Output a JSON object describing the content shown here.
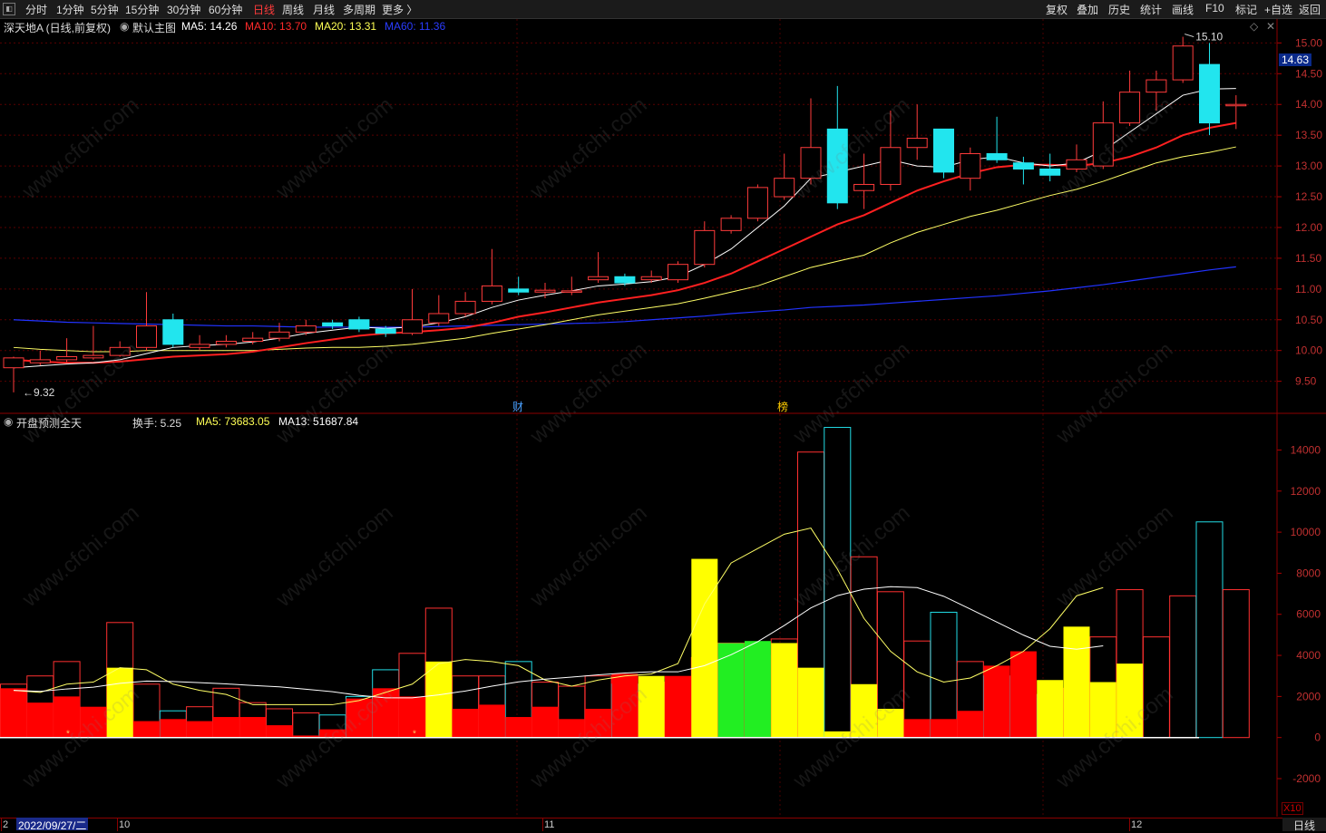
{
  "toolbar": {
    "periods": [
      "分时",
      "1分钟",
      "5分钟",
      "15分钟",
      "30分钟",
      "60分钟",
      "日线",
      "周线",
      "月线",
      "多周期",
      "更多 〉"
    ],
    "active_period": "日线",
    "right_items": [
      "复权",
      "叠加",
      "历史",
      "统计",
      "画线",
      "F10",
      "标记",
      "+自选",
      "返回"
    ]
  },
  "chart_info": {
    "stock_name": "深天地A (日线,前复权)",
    "template": "默认主图",
    "ma5": "MA5: 14.26",
    "ma10": "MA10: 13.70",
    "ma20": "MA20: 13.31",
    "ma60": "MA60: 11.36",
    "current_price": "14.63",
    "high_label": "15.10",
    "low_label": "9.32",
    "event_caiwu": "财",
    "event_bang": "榜"
  },
  "indicator_info": {
    "name": "开盘预测全天",
    "turnover": "换手: 5.25",
    "ma5": "MA5: 73683.05",
    "ma13": "MA13: 51687.84",
    "multiplier": "X10"
  },
  "bottom": {
    "selected_date": "2022/09/27/二",
    "month_labels": [
      "2",
      "10",
      "11",
      "12"
    ],
    "period": "日线"
  },
  "watermark": "www.cfchi.com",
  "colors": {
    "up": "#ff3b3b",
    "down": "#22e5ee",
    "ma5": "#ffffff",
    "ma10": "#ff2020",
    "ma20": "#ffff66",
    "ma60": "#2233ff",
    "vol_red": "#ff0000",
    "vol_yellow": "#ffff00",
    "vol_green": "#22ee22"
  },
  "chart_data": [
    {
      "type": "candlestick",
      "price_axis_ticks": [
        9.5,
        10.0,
        10.5,
        11.0,
        11.5,
        12.0,
        12.5,
        13.0,
        13.5,
        14.0,
        14.5,
        15.0
      ],
      "ylim": [
        9.2,
        15.3
      ],
      "candles": [
        [
          9.72,
          9.88,
          9.32,
          9.9
        ],
        [
          9.8,
          9.85,
          9.76,
          10.0
        ],
        [
          9.85,
          9.9,
          9.8,
          10.2
        ],
        [
          9.88,
          9.92,
          9.85,
          10.4
        ],
        [
          9.92,
          10.05,
          9.9,
          10.15
        ],
        [
          10.05,
          10.4,
          10.0,
          10.95
        ],
        [
          10.5,
          10.1,
          10.05,
          10.6
        ],
        [
          10.05,
          10.1,
          10.0,
          10.25
        ],
        [
          10.1,
          10.15,
          10.05,
          10.25
        ],
        [
          10.15,
          10.2,
          10.1,
          10.3
        ],
        [
          10.2,
          10.3,
          10.15,
          10.45
        ],
        [
          10.3,
          10.4,
          10.25,
          10.5
        ],
        [
          10.45,
          10.4,
          10.35,
          10.5
        ],
        [
          10.5,
          10.35,
          10.3,
          10.55
        ],
        [
          10.35,
          10.28,
          10.22,
          10.4
        ],
        [
          10.28,
          10.5,
          10.25,
          11.0
        ],
        [
          10.45,
          10.6,
          10.4,
          10.9
        ],
        [
          10.6,
          10.8,
          10.55,
          10.95
        ],
        [
          10.8,
          11.05,
          10.75,
          11.65
        ],
        [
          11.0,
          10.95,
          10.9,
          11.2
        ],
        [
          10.95,
          10.98,
          10.85,
          11.1
        ],
        [
          10.95,
          10.97,
          10.9,
          11.2
        ],
        [
          11.15,
          11.2,
          11.1,
          11.6
        ],
        [
          11.2,
          11.1,
          11.05,
          11.25
        ],
        [
          11.15,
          11.2,
          11.1,
          11.3
        ],
        [
          11.15,
          11.4,
          11.1,
          11.45
        ],
        [
          11.4,
          11.95,
          11.35,
          12.1
        ],
        [
          11.95,
          12.15,
          11.9,
          12.2
        ],
        [
          12.15,
          12.65,
          12.1,
          12.7
        ],
        [
          12.5,
          12.8,
          12.45,
          13.2
        ],
        [
          12.8,
          13.3,
          12.7,
          14.1
        ],
        [
          13.6,
          12.4,
          12.3,
          14.3
        ],
        [
          12.6,
          12.7,
          12.3,
          13.2
        ],
        [
          12.7,
          13.3,
          12.6,
          13.9
        ],
        [
          13.3,
          13.45,
          13.1,
          14.0
        ],
        [
          13.6,
          12.9,
          12.8,
          13.6
        ],
        [
          12.8,
          13.2,
          12.6,
          13.3
        ],
        [
          13.2,
          13.1,
          13.05,
          13.8
        ],
        [
          13.05,
          12.95,
          12.7,
          13.15
        ],
        [
          12.95,
          12.85,
          12.75,
          13.2
        ],
        [
          12.95,
          13.1,
          12.9,
          13.35
        ],
        [
          13.0,
          13.7,
          12.95,
          14.05
        ],
        [
          13.7,
          14.2,
          13.65,
          14.55
        ],
        [
          14.2,
          14.4,
          13.9,
          14.55
        ],
        [
          14.4,
          14.95,
          14.35,
          15.1
        ],
        [
          14.65,
          13.7,
          13.5,
          15.0
        ],
        [
          14.0,
          14.0,
          13.6,
          14.15
        ]
      ],
      "ma5": [
        9.72,
        9.75,
        9.78,
        9.8,
        9.85,
        9.95,
        10.05,
        10.08,
        10.1,
        10.14,
        10.2,
        10.28,
        10.33,
        10.38,
        10.36,
        10.38,
        10.45,
        10.55,
        10.7,
        10.82,
        10.9,
        10.97,
        11.05,
        11.08,
        11.12,
        11.2,
        11.4,
        11.65,
        12.0,
        12.35,
        12.8,
        12.9,
        13.0,
        13.1,
        13.0,
        12.98,
        13.1,
        13.15,
        13.05,
        13.0,
        13.05,
        13.25,
        13.55,
        13.85,
        14.15,
        14.25,
        14.26
      ],
      "ma10": [
        9.85,
        9.82,
        9.8,
        9.8,
        9.82,
        9.86,
        9.9,
        9.92,
        9.94,
        9.98,
        10.05,
        10.12,
        10.18,
        10.24,
        10.28,
        10.3,
        10.33,
        10.37,
        10.45,
        10.55,
        10.62,
        10.7,
        10.78,
        10.84,
        10.9,
        10.98,
        11.1,
        11.25,
        11.45,
        11.65,
        11.85,
        12.05,
        12.2,
        12.4,
        12.6,
        12.75,
        12.88,
        12.98,
        13.02,
        13.02,
        13.0,
        13.05,
        13.15,
        13.3,
        13.5,
        13.62,
        13.7
      ],
      "ma20": [
        10.05,
        10.02,
        10.0,
        9.98,
        9.98,
        10.0,
        10.0,
        10.0,
        10.0,
        10.0,
        10.02,
        10.04,
        10.05,
        10.05,
        10.07,
        10.1,
        10.15,
        10.2,
        10.28,
        10.35,
        10.42,
        10.5,
        10.58,
        10.64,
        10.7,
        10.76,
        10.85,
        10.95,
        11.05,
        11.2,
        11.35,
        11.45,
        11.55,
        11.75,
        11.92,
        12.05,
        12.18,
        12.28,
        12.4,
        12.52,
        12.62,
        12.75,
        12.9,
        13.05,
        13.15,
        13.22,
        13.31
      ],
      "ma60": [
        10.5,
        10.48,
        10.46,
        10.45,
        10.44,
        10.43,
        10.42,
        10.41,
        10.4,
        10.4,
        10.39,
        10.38,
        10.38,
        10.38,
        10.38,
        10.38,
        10.39,
        10.4,
        10.41,
        10.42,
        10.43,
        10.44,
        10.45,
        10.47,
        10.5,
        10.53,
        10.56,
        10.6,
        10.63,
        10.66,
        10.7,
        10.72,
        10.74,
        10.77,
        10.8,
        10.83,
        10.86,
        10.89,
        10.93,
        10.97,
        11.02,
        11.07,
        11.13,
        11.19,
        11.25,
        11.31,
        11.36
      ]
    },
    {
      "type": "bar",
      "name": "开盘预测全天",
      "axis_ticks": [
        -2000,
        0,
        2000,
        4000,
        6000,
        8000,
        10000,
        12000,
        14000
      ],
      "ylim": [
        -3500,
        15300
      ],
      "outline_values": [
        2600,
        3000,
        3700,
        1400,
        5600,
        2600,
        1300,
        1500,
        2400,
        1700,
        1400,
        1200,
        1100,
        2000,
        3300,
        4100,
        6300,
        3000,
        3000,
        3700,
        2700,
        2500,
        3000,
        2600,
        2200,
        2700,
        3900,
        4600,
        4000,
        4800,
        13900,
        15100,
        8800,
        7100,
        4700,
        6100,
        3700,
        3000,
        2100,
        1900,
        2400,
        4900,
        7200,
        4900,
        6900,
        10500,
        7200
      ],
      "fill_values": [
        2400,
        1700,
        2000,
        1500,
        3400,
        800,
        900,
        800,
        1000,
        1000,
        600,
        100,
        400,
        1900,
        2400,
        2000,
        3700,
        1400,
        1600,
        1000,
        1500,
        900,
        1400,
        3100,
        3000,
        3000,
        8700,
        4600,
        4700,
        4600,
        3400,
        300,
        2600,
        1400,
        900,
        900,
        1300,
        3500,
        4200,
        2800,
        5400,
        2700,
        3600
      ],
      "fill_colors": [
        "red",
        "red",
        "red",
        "red",
        "yellow",
        "red",
        "red",
        "red",
        "red",
        "red",
        "red",
        "red",
        "red",
        "red",
        "red",
        "red",
        "yellow",
        "red",
        "red",
        "red",
        "red",
        "red",
        "red",
        "red",
        "yellow",
        "red",
        "yellow",
        "green",
        "green",
        "yellow",
        "yellow",
        "yellow",
        "yellow",
        "yellow",
        "red",
        "red",
        "red",
        "red",
        "red",
        "yellow",
        "yellow",
        "yellow",
        "yellow",
        "yellow",
        "yellow",
        "yellow",
        "yellow"
      ],
      "ma5": [
        2300,
        2200,
        2600,
        2700,
        3400,
        3300,
        2600,
        2300,
        2100,
        1600,
        1600,
        1600,
        1600,
        1800,
        2200,
        2600,
        3600,
        3800,
        3700,
        3500,
        2800,
        2500,
        2800,
        3000,
        3100,
        3600,
        6500,
        8500,
        9200,
        9900,
        10200,
        8200,
        5800,
        4200,
        3200,
        2700,
        2900,
        3500,
        4200,
        5300,
        6900,
        7300
      ]
    }
  ]
}
